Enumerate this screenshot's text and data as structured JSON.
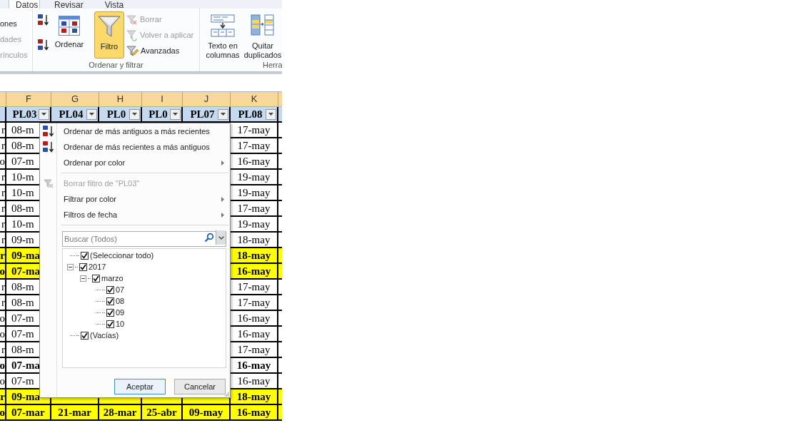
{
  "ribbon": {
    "tabs": [
      {
        "label": "Datos",
        "selected": true
      },
      {
        "label": "Revisar",
        "selected": false
      },
      {
        "label": "Vista",
        "selected": false
      }
    ],
    "cut_group_items": [
      {
        "label": "ones",
        "disabled": false
      },
      {
        "label": "dades",
        "disabled": true
      },
      {
        "label": "rínculos",
        "disabled": true
      }
    ],
    "sort_filter_group": {
      "label": "Ordenar y filtrar",
      "sort_button": "Ordenar",
      "filter_button": {
        "label": "Filtro",
        "on": true
      },
      "small_buttons": [
        {
          "kind": "clear",
          "label": "Borrar",
          "disabled": true
        },
        {
          "kind": "reapply",
          "label": "Volver a aplicar",
          "disabled": true
        },
        {
          "kind": "advanced",
          "label": "Avanzadas",
          "disabled": false
        }
      ]
    },
    "tools_group": {
      "label": "Herra",
      "buttons": [
        {
          "kind": "text_to_columns",
          "lines": [
            "Texto en",
            "columnas"
          ]
        },
        {
          "kind": "remove_duplicates",
          "lines": [
            "Quitar",
            "duplicados"
          ]
        }
      ]
    }
  },
  "sheet": {
    "columns": [
      "F",
      "G",
      "H",
      "I",
      "J",
      "K"
    ],
    "header_cells": [
      "PL03",
      "PL04",
      "PL0",
      "PL0",
      "PL07",
      "PL08"
    ],
    "rows": [
      {
        "e": "r",
        "f": "08-m",
        "k": "17-may",
        "bold": false,
        "highlight": false
      },
      {
        "e": "r",
        "f": "08-m",
        "k": "17-may",
        "bold": false,
        "highlight": false
      },
      {
        "e": "o",
        "f": "07-m",
        "k": "16-may",
        "bold": false,
        "highlight": false
      },
      {
        "e": "r",
        "f": "10-m",
        "k": "19-may",
        "bold": false,
        "highlight": false
      },
      {
        "e": "r",
        "f": "10-m",
        "k": "19-may",
        "bold": false,
        "highlight": false
      },
      {
        "e": "r",
        "f": "08-m",
        "k": "17-may",
        "bold": false,
        "highlight": false
      },
      {
        "e": "r",
        "f": "10-m",
        "k": "19-may",
        "bold": false,
        "highlight": false
      },
      {
        "e": "r",
        "f": "09-m",
        "k": "18-may",
        "bold": false,
        "highlight": false
      },
      {
        "e": "r",
        "f": "09-ma",
        "k": "18-may",
        "bold": true,
        "highlight": true
      },
      {
        "e": "o",
        "f": "07-ma",
        "k": "16-may",
        "bold": true,
        "highlight": true
      },
      {
        "e": "r",
        "f": "08-m",
        "k": "17-may",
        "bold": false,
        "highlight": false
      },
      {
        "e": "r",
        "f": "08-m",
        "k": "17-may",
        "bold": false,
        "highlight": false
      },
      {
        "e": "o",
        "f": "07-m",
        "k": "16-may",
        "bold": false,
        "highlight": false
      },
      {
        "e": "o",
        "f": "07-m",
        "k": "16-may",
        "bold": false,
        "highlight": false
      },
      {
        "e": "r",
        "f": "08-m",
        "k": "17-may",
        "bold": false,
        "highlight": false
      },
      {
        "e": "o",
        "f": "07-ma",
        "k": "16-may",
        "bold": true,
        "highlight": false
      },
      {
        "e": "o",
        "f": "07-m",
        "k": "16-may",
        "bold": false,
        "highlight": false
      },
      {
        "e": "r",
        "f": "09-ma",
        "k": "18-may",
        "bold": true,
        "highlight": true
      },
      {
        "e": "o",
        "f": "07-mar",
        "g": "21-mar",
        "h": "28-mar",
        "i": "25-abr",
        "j": "09-may",
        "k": "16-may",
        "bold": true,
        "highlight": true
      }
    ]
  },
  "filter_menu": {
    "items": [
      {
        "kind": "sort_asc",
        "label": "Ordenar de más antiguos a más recientes",
        "disabled": false,
        "submenu": false
      },
      {
        "kind": "sort_desc",
        "label": "Ordenar de más recientes a más antiguos",
        "disabled": false,
        "submenu": false
      },
      {
        "kind": "plain",
        "label": "Ordenar por color",
        "disabled": false,
        "submenu": true
      },
      {
        "kind": "separator"
      },
      {
        "kind": "clear_filter",
        "label": "Borrar filtro de \"PL03\"",
        "disabled": true,
        "submenu": false
      },
      {
        "kind": "plain",
        "label": "Filtrar por color",
        "disabled": false,
        "submenu": true
      },
      {
        "kind": "plain",
        "label": "Filtros de fecha",
        "disabled": false,
        "submenu": true
      },
      {
        "kind": "separator"
      }
    ],
    "search": {
      "placeholder": "Buscar (Todos)"
    },
    "tree": [
      {
        "label": "(Seleccionar todo)",
        "checked": true
      },
      {
        "label": "2017",
        "checked": true,
        "expanded": true,
        "children": [
          {
            "label": "marzo",
            "checked": true,
            "expanded": true,
            "children": [
              {
                "label": "07",
                "checked": true
              },
              {
                "label": "08",
                "checked": true
              },
              {
                "label": "09",
                "checked": true
              },
              {
                "label": "10",
                "checked": true
              }
            ]
          }
        ]
      },
      {
        "label": "(Vacías)",
        "checked": true
      }
    ],
    "buttons": [
      {
        "label": "Aceptar",
        "default": true
      },
      {
        "label": "Cancelar",
        "default": false
      }
    ]
  }
}
